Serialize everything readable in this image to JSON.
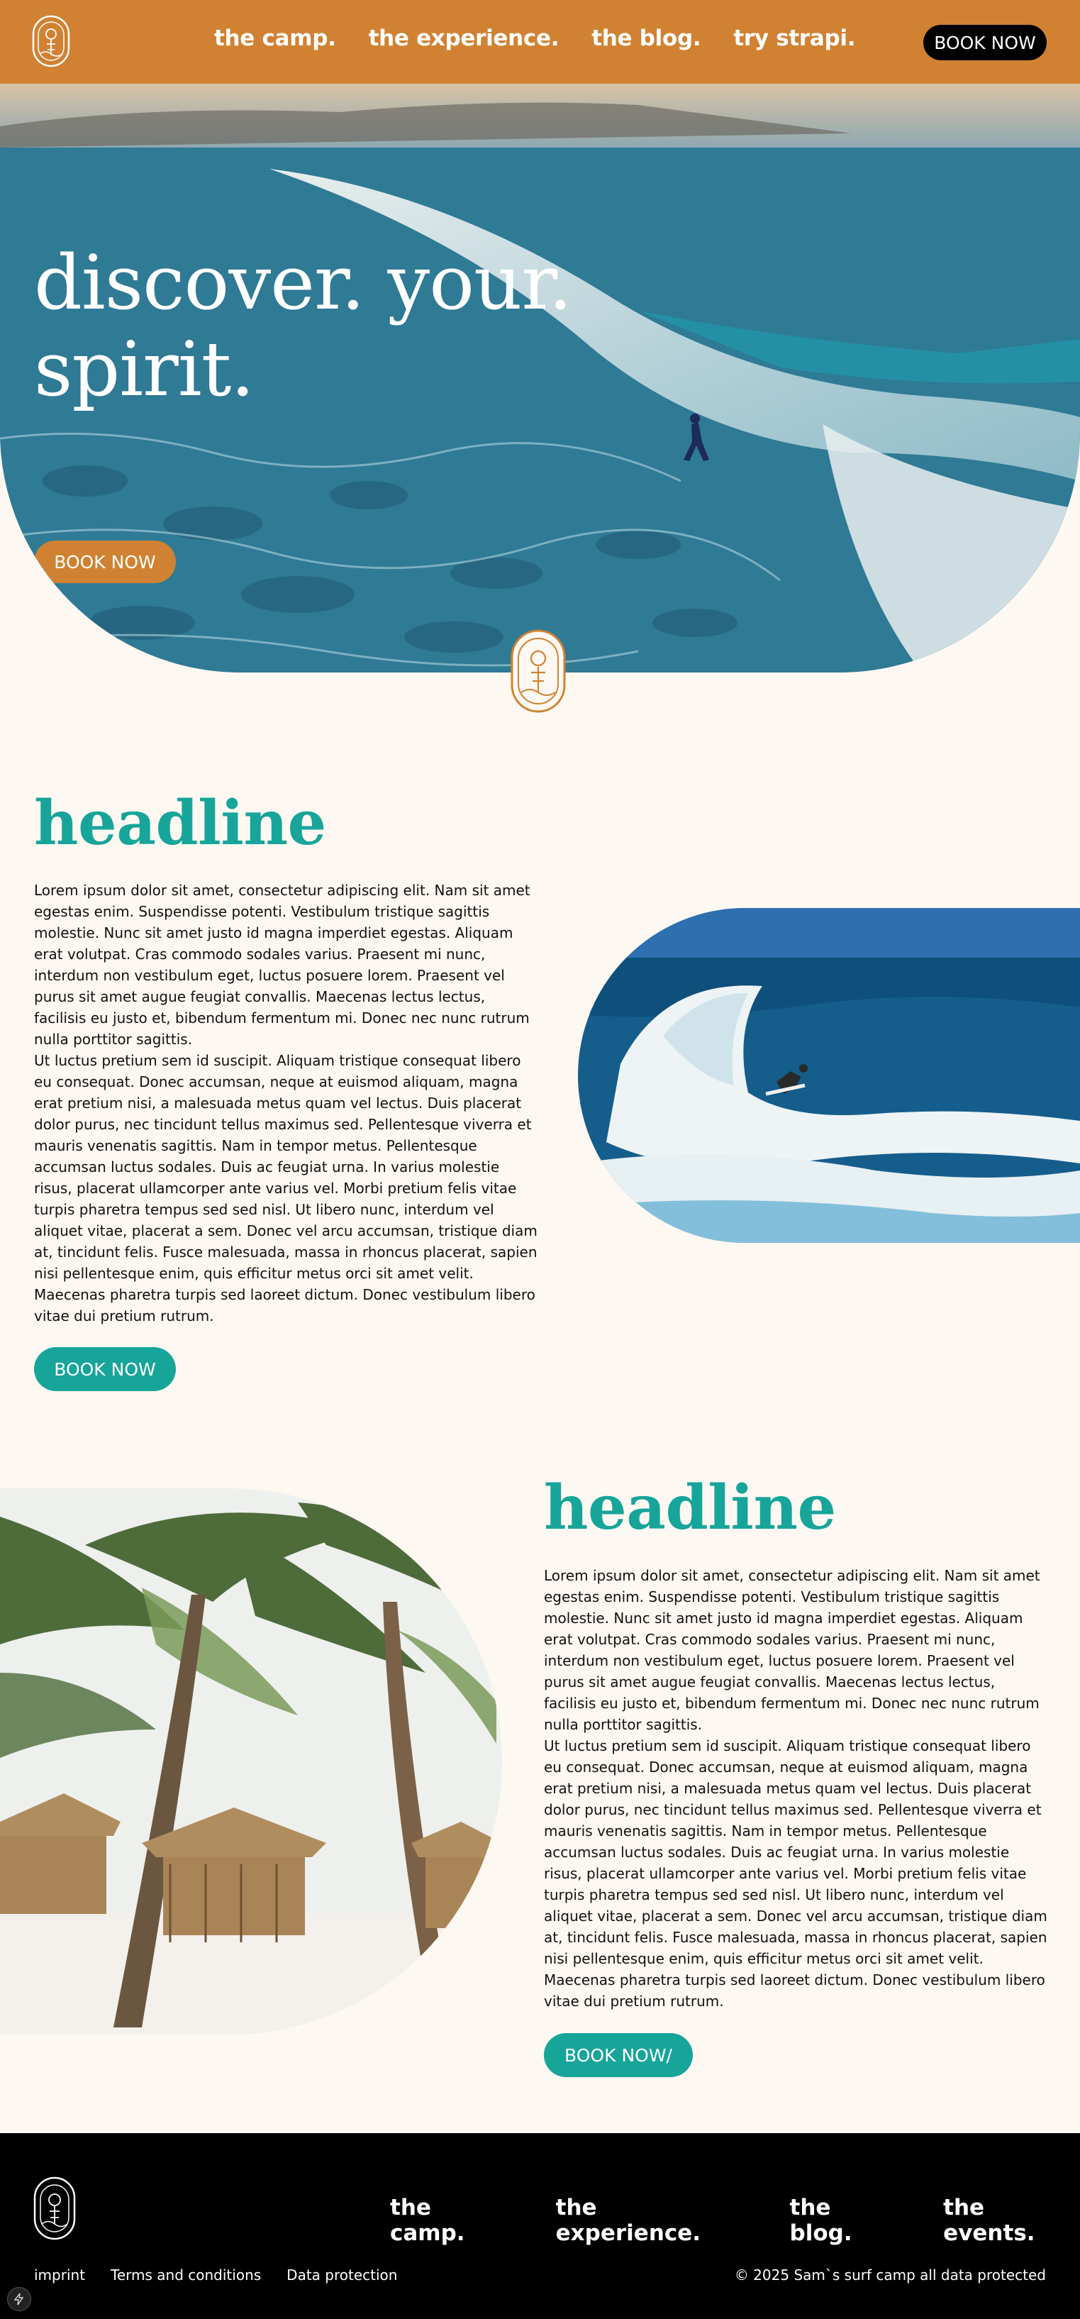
{
  "header": {
    "nav": [
      "the camp.",
      "the experience.",
      "the blog.",
      "try strapi."
    ],
    "book_label": "BOOK NOW"
  },
  "hero": {
    "title_line1": "discover. your.",
    "title_line2": "spirit.",
    "button_label": "BOOK NOW"
  },
  "section1": {
    "headline": "headline",
    "paragraph1": "Lorem ipsum dolor sit amet, consectetur adipiscing elit. Nam sit amet egestas enim. Suspendisse potenti. Vestibulum tristique sagittis molestie. Nunc sit amet justo id magna imperdiet egestas. Aliquam erat volutpat. Cras commodo sodales varius. Praesent mi nunc, interdum non vestibulum eget, luctus posuere lorem. Praesent vel purus sit amet augue feugiat convallis. Maecenas lectus lectus, facilisis eu justo et, bibendum fermentum mi. Donec nec nunc rutrum nulla porttitor sagittis.",
    "paragraph2": "Ut luctus pretium sem id suscipit. Aliquam tristique consequat libero eu consequat. Donec accumsan, neque at euismod aliquam, magna erat pretium nisi, a malesuada metus quam vel lectus. Duis placerat dolor purus, nec tincidunt tellus maximus sed. Pellentesque viverra et mauris venenatis sagittis. Nam in tempor metus. Pellentesque accumsan luctus sodales. Duis ac feugiat urna. In varius molestie risus, placerat ullamcorper ante varius vel. Morbi pretium felis vitae turpis pharetra tempus sed sed nisl. Ut libero nunc, interdum vel aliquet vitae, placerat a sem. Donec vel arcu accumsan, tristique diam at, tincidunt felis. Fusce malesuada, massa in rhoncus placerat, sapien nisi pellentesque enim, quis efficitur metus orci sit amet velit. Maecenas pharetra turpis sed laoreet dictum. Donec vestibulum libero vitae dui pretium rutrum.",
    "button_label": "BOOK NOW"
  },
  "section2": {
    "headline": "headline",
    "paragraph1": "Lorem ipsum dolor sit amet, consectetur adipiscing elit. Nam sit amet egestas enim. Suspendisse potenti. Vestibulum tristique sagittis molestie. Nunc sit amet justo id magna imperdiet egestas. Aliquam erat volutpat. Cras commodo sodales varius. Praesent mi nunc, interdum non vestibulum eget, luctus posuere lorem. Praesent vel purus sit amet augue feugiat convallis. Maecenas lectus lectus, facilisis eu justo et, bibendum fermentum mi. Donec nec nunc rutrum nulla porttitor sagittis.",
    "paragraph2": "Ut luctus pretium sem id suscipit. Aliquam tristique consequat libero eu consequat. Donec accumsan, neque at euismod aliquam, magna erat pretium nisi, a malesuada metus quam vel lectus. Duis placerat dolor purus, nec tincidunt tellus maximus sed. Pellentesque viverra et mauris venenatis sagittis. Nam in tempor metus. Pellentesque accumsan luctus sodales. Duis ac feugiat urna. In varius molestie risus, placerat ullamcorper ante varius vel. Morbi pretium felis vitae turpis pharetra tempus sed sed nisl. Ut libero nunc, interdum vel aliquet vitae, placerat a sem. Donec vel arcu accumsan, tristique diam at, tincidunt felis. Fusce malesuada, massa in rhoncus placerat, sapien nisi pellentesque enim, quis efficitur metus orci sit amet velit. Maecenas pharetra turpis sed laoreet dictum. Donec vestibulum libero vitae dui pretium rutrum.",
    "button_label": "BOOK NOW/"
  },
  "footer": {
    "nav": [
      "the camp.",
      "the experience.",
      "the blog.",
      "the events."
    ],
    "links": [
      "imprint",
      "Terms and conditions",
      "Data protection"
    ],
    "copyright": "© 2025 Sam`s surf camp all data protected"
  },
  "icons": {
    "logo": "surf-camp-logo-icon",
    "badge": "surf-camp-badge-icon",
    "bolt": "lightning-icon"
  },
  "colors": {
    "header_bg": "#d08232",
    "accent_teal": "#17a59a",
    "page_bg": "#fdf8f2",
    "footer_bg": "#000000"
  }
}
